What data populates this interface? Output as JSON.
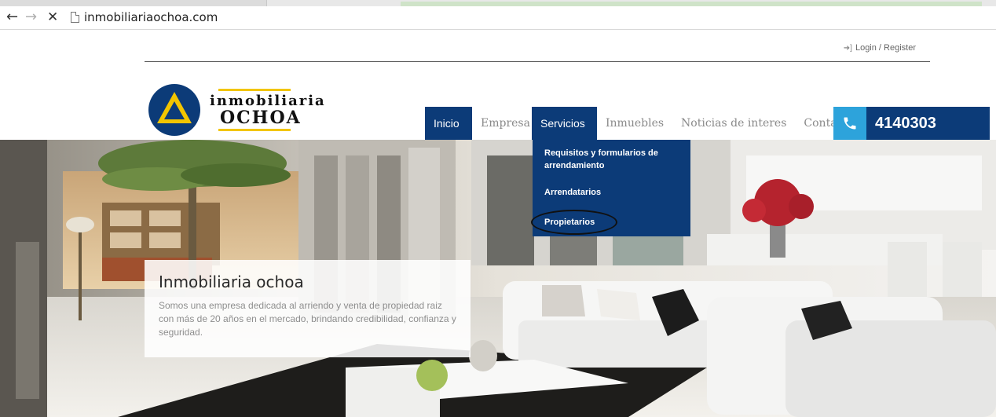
{
  "browser": {
    "back_icon": "arrow-left-icon",
    "forward_icon": "arrow-right-icon",
    "stop_icon": "close-icon",
    "back_glyph": "←",
    "forward_glyph": "→",
    "stop_glyph": "✕",
    "url": "inmobiliariaochoa.com"
  },
  "header": {
    "login_label": "Login / Register",
    "login_icon": "sign-in-icon",
    "logo_line1": "inmobiliaria",
    "logo_line2": "OCHOA"
  },
  "menu": {
    "items": [
      {
        "label": "Inicio"
      },
      {
        "label": "Empresa"
      },
      {
        "label": "Servicios"
      },
      {
        "label": "Inmuebles"
      },
      {
        "label": "Noticias de interes"
      },
      {
        "label": "Contacto"
      }
    ],
    "phone_icon": "phone-icon",
    "phone": "4140303"
  },
  "dropdown": {
    "items": [
      {
        "label": "Requisitos y formularios de arrendamiento"
      },
      {
        "label": "Arrendatarios"
      },
      {
        "label": "Propietarios"
      }
    ]
  },
  "hero": {
    "title": "Inmobiliaria ochoa",
    "text": "Somos una empresa dedicada al arriendo y venta de propiedad raiz con más de 20 años en el mercado, brindando credibilidad, confianza y seguridad."
  },
  "colors": {
    "brand_blue": "#0c3b78",
    "accent_cyan": "#2da3db",
    "logo_yellow": "#f2c500"
  }
}
